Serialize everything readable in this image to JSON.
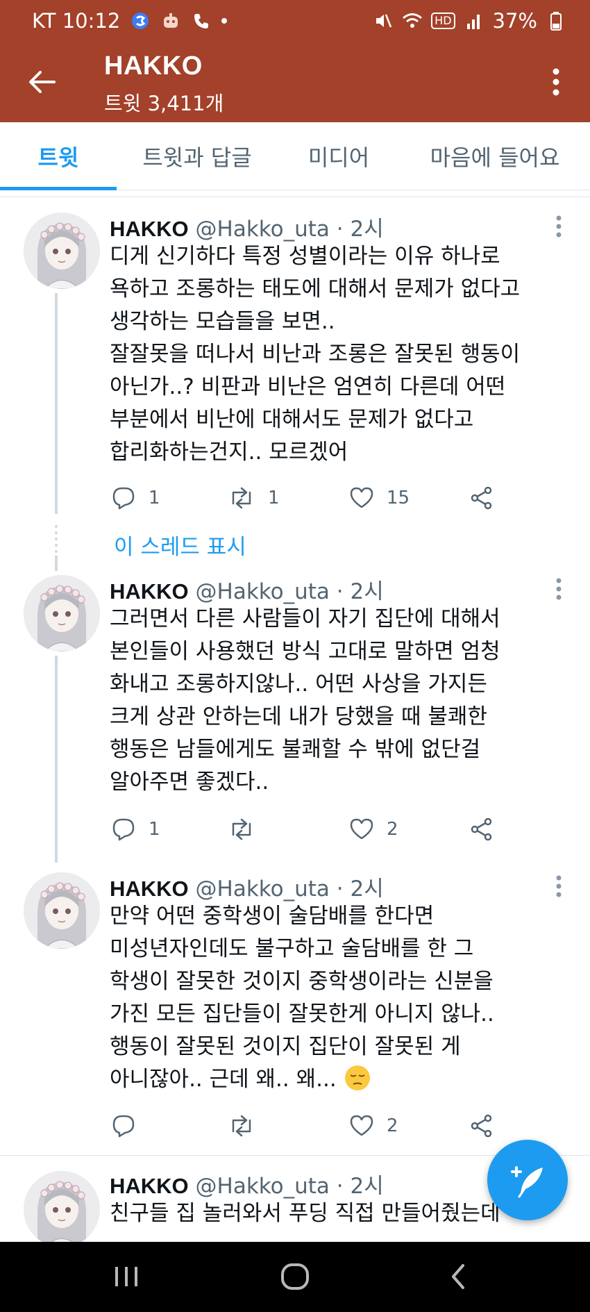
{
  "status_bar": {
    "carrier_time": "KT 10:12",
    "battery": "37%",
    "hd_label": "HD",
    "left_icons": [
      "s-app-icon",
      "robot-icon",
      "call-icon"
    ],
    "right_icons": [
      "mute-icon",
      "wifi-icon",
      "hd-icon",
      "signal-icon",
      "battery-icon"
    ]
  },
  "header": {
    "title": "HAKKO",
    "subtitle": "트윗 3,411개",
    "header_color": "#a3412a"
  },
  "tabs": [
    {
      "label": "트윗",
      "active": true
    },
    {
      "label": "트윗과 답글",
      "active": false
    },
    {
      "label": "미디어",
      "active": false
    },
    {
      "label": "마음에 들어요",
      "active": false
    }
  ],
  "accent_color": "#1d9bf0",
  "show_thread_label": "이 스레드 표시",
  "tweets": [
    {
      "name": "HAKKO",
      "handle": "@Hakko_uta",
      "separator": "·",
      "time": "2시",
      "lines": [
        "디게 신기하다 특정 성별이라는 이유 하나로",
        "욕하고 조롱하는 태도에 대해서 문제가 없다고",
        "생각하는 모습들을 보면..",
        "잘잘못을 떠나서 비난과 조롱은 잘못된 행동이",
        "아닌가..? 비판과 비난은 엄연히 다른데 어떤",
        "부분에서 비난에 대해서도 문제가 없다고",
        "합리화하는건지.. 모르겠어"
      ],
      "replies": "1",
      "retweets": "1",
      "likes": "15"
    },
    {
      "name": "HAKKO",
      "handle": "@Hakko_uta",
      "separator": "·",
      "time": "2시",
      "lines": [
        "그러면서 다른 사람들이 자기 집단에 대해서",
        "본인들이 사용했던 방식 고대로 말하면 엄청",
        "화내고 조롱하지않나.. 어떤 사상을 가지든",
        "크게 상관 안하는데 내가 당했을 때 불쾌한",
        "행동은 남들에게도 불쾌할 수 밖에 없단걸",
        "알아주면 좋겠다.."
      ],
      "replies": "1",
      "retweets": "",
      "likes": "2"
    },
    {
      "name": "HAKKO",
      "handle": "@Hakko_uta",
      "separator": "·",
      "time": "2시",
      "lines": [
        "만약 어떤 중학생이 술담배를 한다면",
        "미성년자인데도 불구하고 술담배를 한 그",
        "학생이 잘못한 것이지 중학생이라는 신분을",
        "가진 모든 집단들이 잘못한게 아니지 않나..",
        "행동이 잘못된 것이지 집단이 잘못된 게",
        "아니잖아.. 근데 왜.. 왜..."
      ],
      "emoji": "pensive-face",
      "replies": "",
      "retweets": "",
      "likes": "2"
    },
    {
      "name": "HAKKO",
      "handle": "@Hakko_uta",
      "separator": "·",
      "time": "2시",
      "lines": [
        "친구들 집 놀러와서 푸딩 직접 만들어줬는데"
      ]
    }
  ],
  "fab": {
    "icon": "compose-tweet-icon"
  },
  "nav_bar": {
    "icons": [
      "recent-apps-icon",
      "home-icon",
      "back-icon"
    ]
  }
}
